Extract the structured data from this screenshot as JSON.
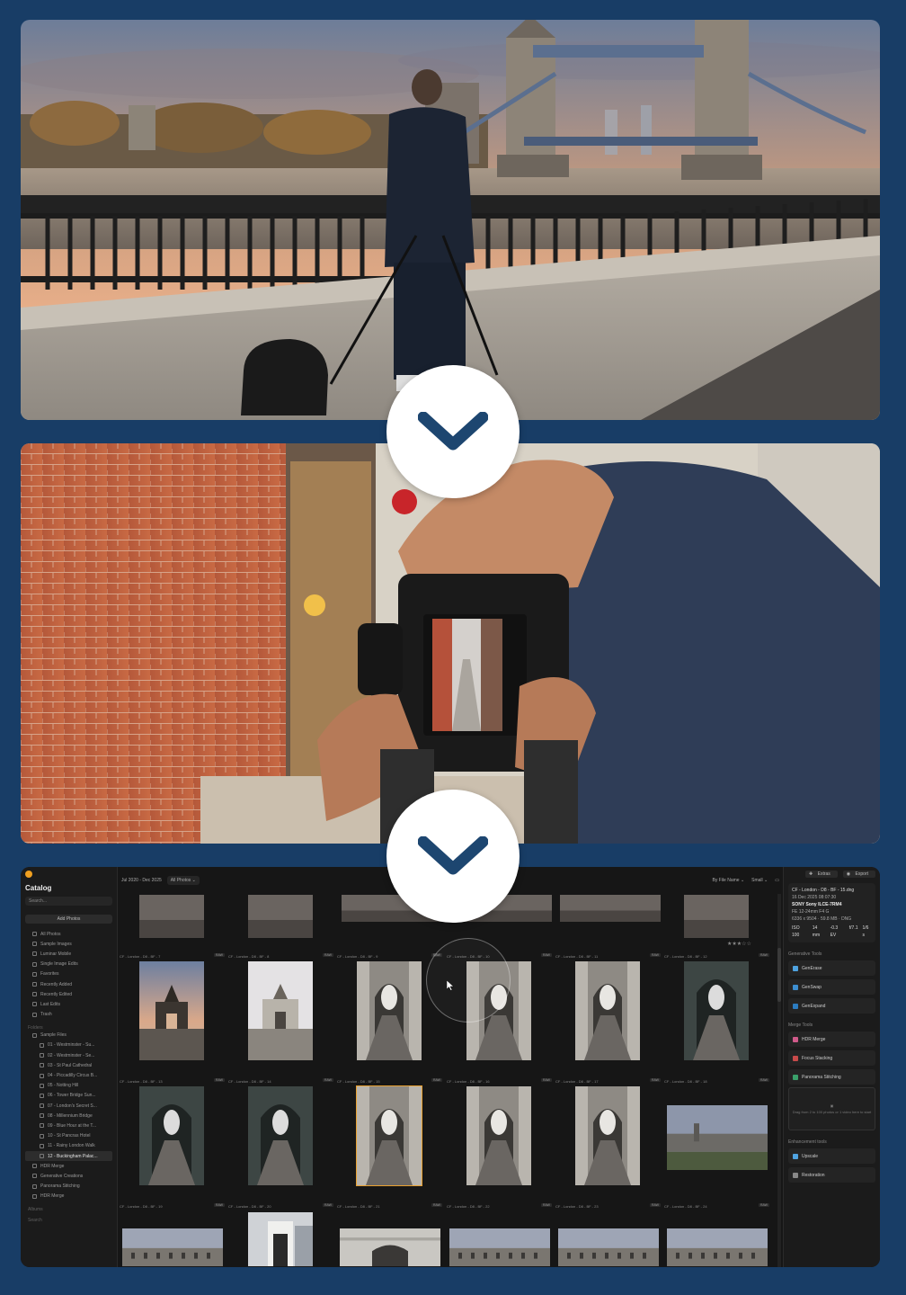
{
  "catalog": {
    "title": "Catalog",
    "search_placeholder": "Search...",
    "add_photos": "Add Photos",
    "library": [
      "All Photos",
      "Sample Images",
      "Luminar Mobile",
      "Single Image Edits",
      "Favorites",
      "Recently Added",
      "Recently Edited",
      "Last Edits",
      "Trash"
    ],
    "folders_label": "Folders",
    "sample_files": "Sample Files",
    "folders": [
      "01 - Westminster - Su...",
      "02 - Westminster - Se...",
      "03 - St Paul Cathedral",
      "04 - Piccadilly Circus B...",
      "05 - Notting Hill",
      "06 - Tower Bridge Sun...",
      "07 - London's Secret S...",
      "08 - Millennium Bridge",
      "09 - Blue Hour at the T...",
      "10 - St Pancras Hotel",
      "11 - Rainy London Walk",
      "12 - Buckingham Palac..."
    ],
    "other_folders": [
      "HDR Merge",
      "Generative Creations",
      "Panorama Stitching",
      "HDR Merge"
    ],
    "albums_label": "Albums",
    "smart_label": "Search"
  },
  "toolbar": {
    "date_range": "Jul 2020 - Dec 2025",
    "filter": "All Photos",
    "sort": "By File Name",
    "size": "Small"
  },
  "grid": {
    "raw_badge": "RAW",
    "rows": [
      [
        "CF - London - D8 - BF - 7",
        "CF - London - D8 - BF - 8",
        "CF - London - D8 - BF - 9",
        "CF - London - D8 - BF - 10",
        "CF - London - D8 - BF - 11",
        "CF - London - D8 - BF - 12"
      ],
      [
        "CF - London - D8 - BF - 13",
        "CF - London - D8 - BF - 14",
        "CF - London - D8 - BF - 15",
        "CF - London - D8 - BF - 16",
        "CF - London - D8 - BF - 17",
        "CF - London - D8 - BF - 18"
      ],
      [
        "CF - London - D8 - BF - 19",
        "CF - London - D8 - BF - 20",
        "CF - London - D8 - BF - 21",
        "CF - London - D8 - BF - 22",
        "CF - London - D8 - BF - 23",
        "CF - London - D8 - BF - 24"
      ]
    ],
    "rating": "★★★☆☆"
  },
  "right_panel": {
    "extras": "Extras",
    "export": "Export",
    "file_name": "CF - London - D8 - BF - 15.dng",
    "date": "16 Dec 2025 08:07:30",
    "camera": "SONY Sony ILCE-7RM4",
    "lens": "FE 12-24mm F4 G",
    "dimensions": "6336 x 9504",
    "file_size": "59.8 MB",
    "format": "DNG",
    "iso": "ISO 100",
    "focal": "14 mm",
    "ev": "-0.3 EV",
    "aperture": "f/7.1",
    "shutter": "1/6 s",
    "generative_title": "Generative Tools",
    "generative": [
      "GenErase",
      "GenSwap",
      "GenExpand"
    ],
    "merge_title": "Merge Tools",
    "merge": [
      "HDR Merge",
      "Focus Stacking",
      "Panorama Stitching"
    ],
    "drop_hint": "Drag from 2 to 100 photos or 1 video here to start",
    "enhance_title": "Enhancement tools",
    "enhance": [
      "Upscale",
      "Restoration"
    ]
  },
  "colors": {
    "background": "#183d66",
    "chevron": "#1d4670",
    "accent": "#e8a030"
  }
}
